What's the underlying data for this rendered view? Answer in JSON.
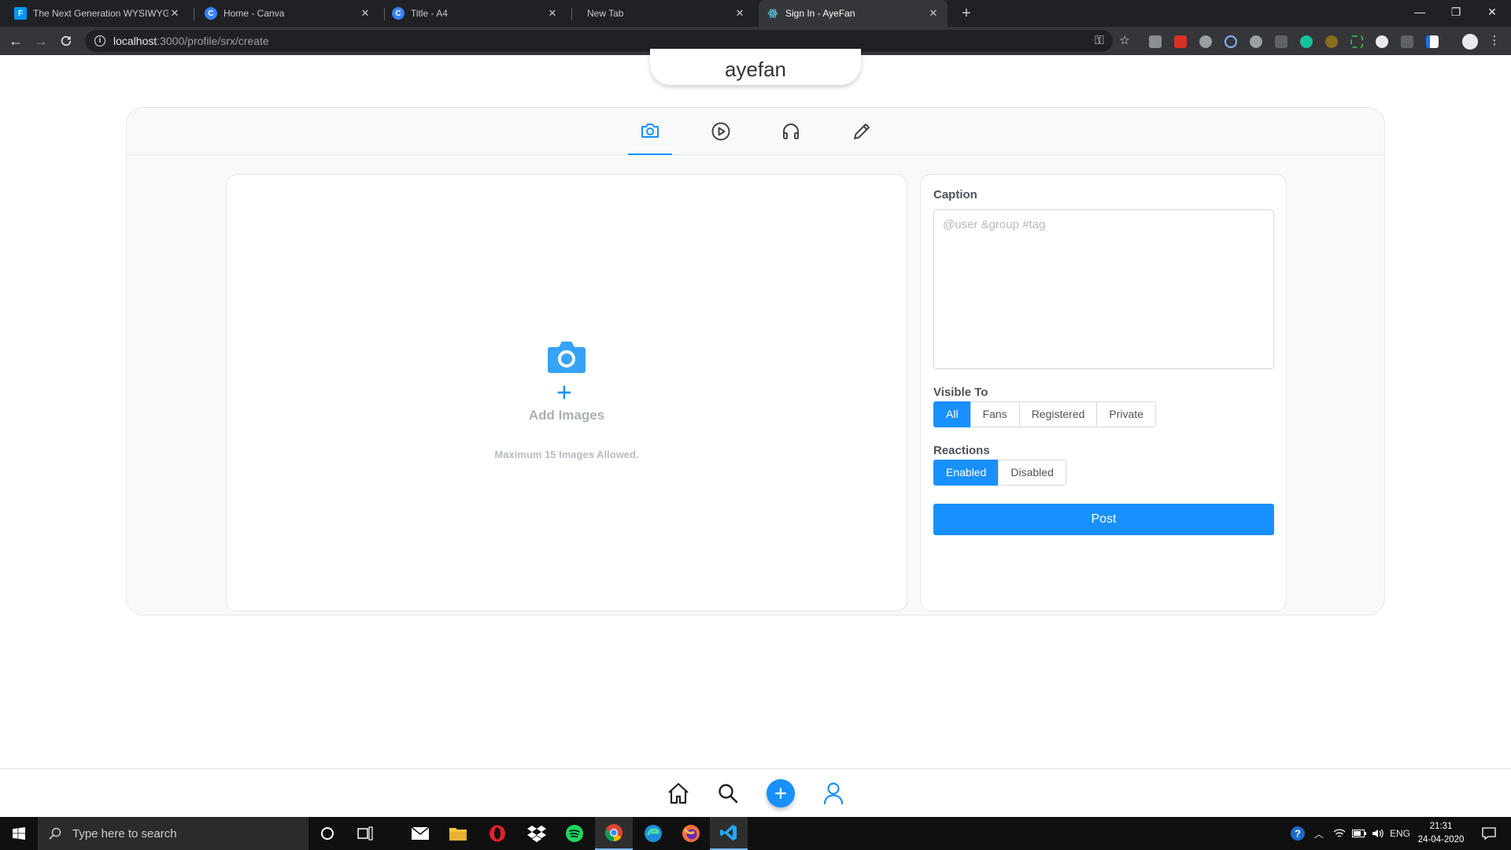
{
  "browser": {
    "tabs": [
      {
        "label": "The Next Generation WYSIWYG I",
        "favicon": "froala-icon",
        "color": "#0098f7"
      },
      {
        "label": "Home - Canva",
        "favicon": "canva-icon",
        "color": "#3b82f6"
      },
      {
        "label": "Title - A4",
        "favicon": "canva-icon",
        "color": "#3b82f6"
      },
      {
        "label": "New Tab",
        "favicon": "",
        "color": ""
      },
      {
        "label": "Sign In - AyeFan",
        "favicon": "react-icon",
        "color": "#61dafb"
      }
    ],
    "url_host": "localhost",
    "url_path": ":3000/profile/srx/create"
  },
  "app": {
    "brand": "ayefan",
    "media_tabs": [
      "camera-icon",
      "video-play-icon",
      "headphones-icon",
      "pencil-icon"
    ],
    "uploader": {
      "label": "Add Images",
      "hint": "Maximum 15 Images Allowed."
    },
    "form": {
      "caption_label": "Caption",
      "caption_placeholder": "@user &group #tag",
      "visible_label": "Visible To",
      "visible_options": [
        "All",
        "Fans",
        "Registered",
        "Private"
      ],
      "visible_selected": "All",
      "reactions_label": "Reactions",
      "reactions_options": [
        "Enabled",
        "Disabled"
      ],
      "reactions_selected": "Enabled",
      "post_label": "Post"
    },
    "accent_color": "#1890ff"
  },
  "taskbar": {
    "search_placeholder": "Type here to search",
    "language": "ENG",
    "time": "21:31",
    "date": "24-04-2020"
  }
}
